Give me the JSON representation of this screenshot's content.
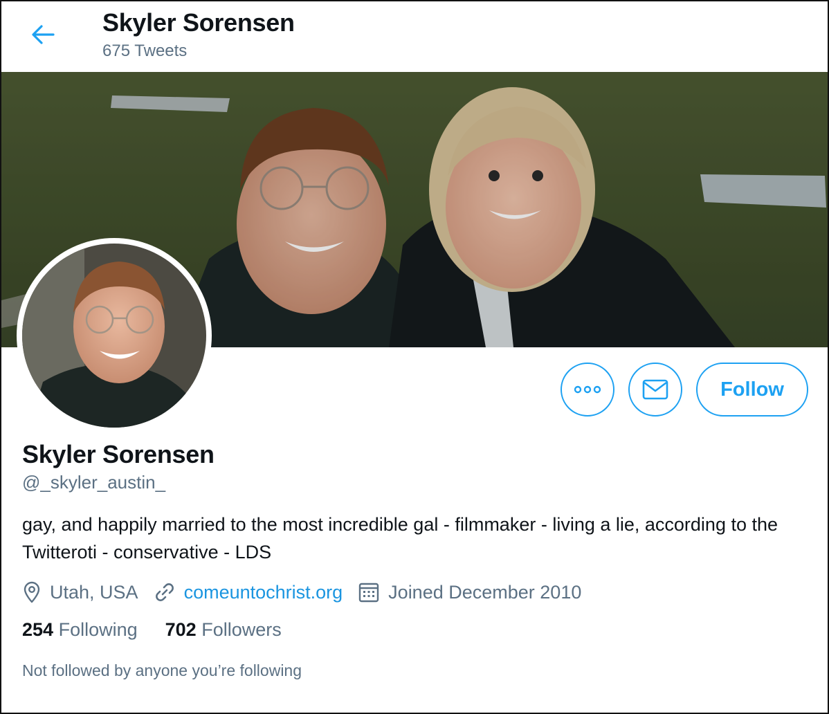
{
  "header": {
    "name": "Skyler Sorensen",
    "tweet_count": "675 Tweets"
  },
  "profile": {
    "name": "Skyler Sorensen",
    "handle": "@_skyler_austin_",
    "bio": "gay, and happily married to the most incredible gal - filmmaker - living a lie, according to the Twitteroti - conservative - LDS",
    "location": "Utah, USA",
    "website": "comeuntochrist.org",
    "joined": "Joined December 2010"
  },
  "actions": {
    "more_icon": "more-icon",
    "message_icon": "mail-icon",
    "follow_label": "Follow"
  },
  "stats": {
    "following_count": "254",
    "following_label": "Following",
    "followers_count": "702",
    "followers_label": "Followers"
  },
  "social_note": "Not followed by anyone you’re following",
  "colors": {
    "accent": "#1da1f2",
    "link": "#1b95e0",
    "secondary_text": "#5b7083",
    "primary_text": "#0f1419"
  }
}
